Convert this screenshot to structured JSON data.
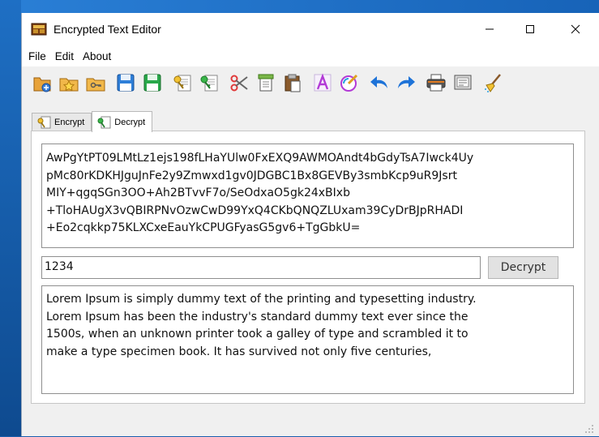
{
  "window": {
    "title": "Encrypted Text Editor"
  },
  "menu": [
    {
      "label": "File"
    },
    {
      "label": "Edit"
    },
    {
      "label": "About"
    }
  ],
  "toolbar": {
    "icons": [
      "new-icon",
      "open-favorite-icon",
      "open-key-icon",
      "save-icon",
      "save-as-icon",
      "key-doc-icon",
      "key-doc-green-icon",
      "cut-icon",
      "copy-icon",
      "paste-icon",
      "font-icon",
      "color-icon",
      "undo-icon",
      "redo-icon",
      "print-icon",
      "print-preview-icon",
      "clear-icon"
    ]
  },
  "tabs": [
    {
      "label": "Encrypt",
      "active": false
    },
    {
      "label": "Decrypt",
      "active": true
    }
  ],
  "decrypt": {
    "ciphertext": "AwPgYtPT09LMtLz1ejs198fLHaYUlw0FxEXQ9AWMOAndt4bGdyTsA7Iwck4Uy\npMc80rKDKHJguJnFe2y9Zmwxd1gv0JDGBC1Bx8GEVBy3smbKcp9uR9Jsrt\nMIY+qgqSGn3OO+Ah2BTvvF7o/SeOdxaO5gk24xBIxb\n+TloHAUgX3vQBIRPNvOzwCwD99YxQ4CKbQNQZLUxam39CyDrBJpRHADI\n+Eo2cqkkp75KLXCxeEauYkCPUGFyasG5gv6+TgGbkU=",
    "password": "1234",
    "button_label": "Decrypt",
    "plaintext": "Lorem Ipsum is simply dummy text of the printing and typesetting industry.\nLorem Ipsum has been the industry's standard dummy text ever since the\n1500s, when an unknown printer took a galley of type and scrambled it to\nmake a type specimen book. It has survived not only five centuries,"
  },
  "colors": {
    "accent_blue": "#1e73d8",
    "desktop": "#1a5fae",
    "window_bg": "#f0f0f0"
  }
}
